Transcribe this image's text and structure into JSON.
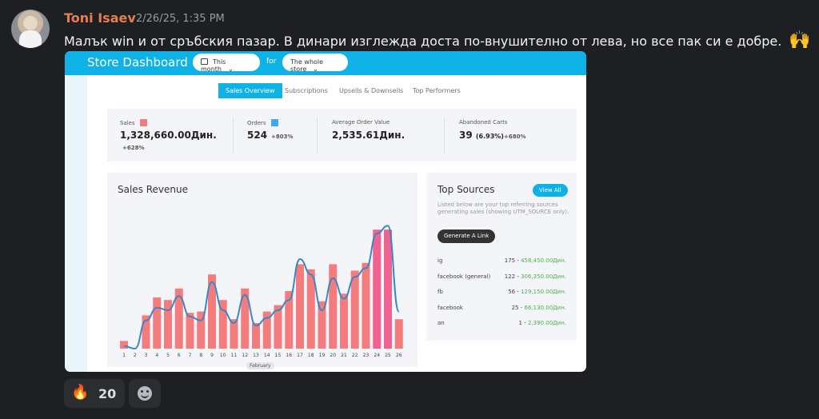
{
  "message": {
    "username": "Toni Isaev",
    "timestamp": "2/26/25, 1:35 PM",
    "text": "Малък win и от сръбския пазар.  В динари изглежда доста по-внушително от лева, но все пак си е добре.",
    "emoji": "🙌"
  },
  "dashboard": {
    "title": "Store Dashboard",
    "period_select": "This month",
    "for_label": "for",
    "store_select": "The whole store",
    "tabs": [
      "Sales Overview",
      "Subscriptions",
      "Upsells & Downsells",
      "Top Performers"
    ],
    "active_tab": "Sales Overview",
    "kpis": [
      {
        "label": "Sales",
        "value": "1,328,660.00Дин.",
        "change": "+628%",
        "change_color": "green",
        "swatch": "#f47c7c"
      },
      {
        "label": "Orders",
        "value": "524",
        "change": "+803%",
        "change_color": "green",
        "swatch": "#3fa9f5"
      },
      {
        "label": "Average Order Value",
        "value": "2,535.61Дин.",
        "change": "",
        "change_color": "green",
        "swatch": ""
      },
      {
        "label": "Abandoned Carts",
        "value": "39",
        "value_extra": "(6.93%)",
        "change": "+680%",
        "change_color": "red",
        "swatch": ""
      }
    ],
    "revenue_title": "Sales Revenue",
    "month_label": "February",
    "sources": {
      "title": "Top Sources",
      "view_all": "View All",
      "description": "Listed below are your top referring sources generating sales (showing UTM_SOURCE only).",
      "generate_link": "Generate A Link",
      "rows": [
        {
          "name": "ig",
          "count": "175",
          "amount": "458,450.00Дин."
        },
        {
          "name": "facebook (general)",
          "count": "122",
          "amount": "306,350.00Дин."
        },
        {
          "name": "fb",
          "count": "56",
          "amount": "129,150.00Дин."
        },
        {
          "name": "facebook",
          "count": "25",
          "amount": "66,130.00Дин."
        },
        {
          "name": "an",
          "count": "1",
          "amount": "2,390.00Дин."
        }
      ]
    }
  },
  "chart_data": {
    "type": "bar",
    "title": "Sales Revenue",
    "xlabel": "February",
    "categories": [
      "1",
      "2",
      "3",
      "4",
      "5",
      "6",
      "7",
      "8",
      "9",
      "10",
      "11",
      "12",
      "13",
      "14",
      "15",
      "16",
      "17",
      "18",
      "19",
      "20",
      "21",
      "22",
      "23",
      "24",
      "25",
      "26"
    ],
    "series": [
      {
        "values": [
          6,
          0,
          26,
          40,
          38,
          47,
          28,
          29,
          58,
          38,
          23,
          47,
          20,
          29,
          34,
          45,
          66,
          62,
          37,
          66,
          43,
          61,
          67,
          93,
          93,
          23
        ]
      },
      {
        "values": [
          2,
          0,
          22,
          32,
          30,
          41,
          25,
          22,
          52,
          30,
          20,
          42,
          18,
          24,
          30,
          38,
          70,
          58,
          30,
          55,
          39,
          56,
          63,
          90,
          96,
          29
        ]
      }
    ],
    "ylim": [
      0,
      100
    ],
    "colors": {
      "bars": "#f47c7c",
      "bars_peak": "#f06292",
      "line": "#3a86c8"
    },
    "grid": false,
    "legend": "none"
  },
  "reactions": [
    {
      "emoji": "🔥",
      "count": "20"
    }
  ],
  "icons": [
    "calendar-icon",
    "chevron-down-icon",
    "add-reaction-icon"
  ]
}
